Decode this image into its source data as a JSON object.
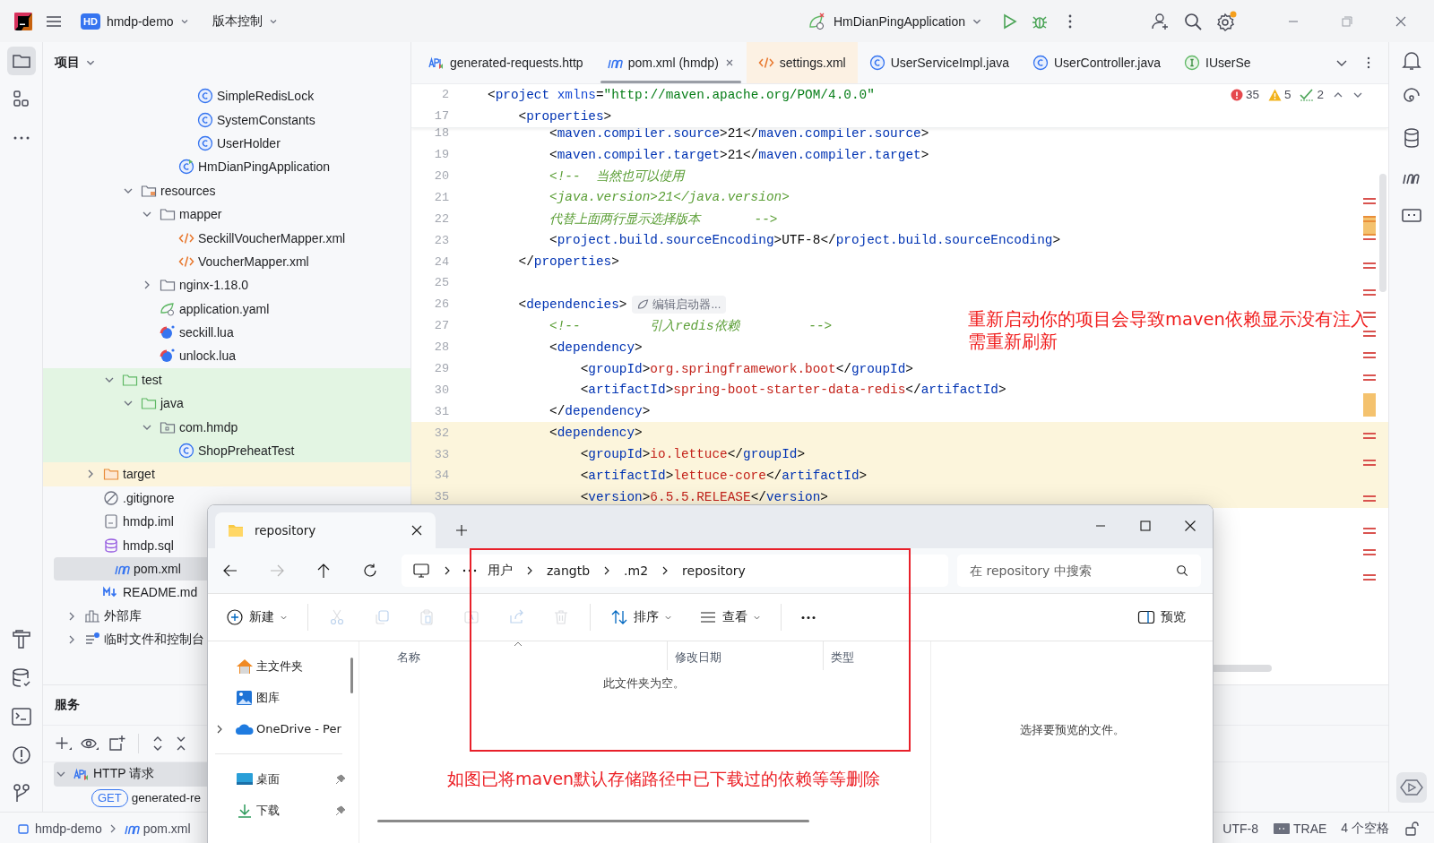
{
  "title_bar": {
    "project_badge": "HD",
    "project": "hmdp-demo",
    "vcs_menu": "版本控制",
    "run_configuration": "HmDianPingApplication",
    "settings_badge": true
  },
  "left_toolbar": {
    "project_selected": true
  },
  "project_panel": {
    "title": "项目",
    "tree": [
      {
        "children": [
          {
            "children": [
              {
                "children": [
                  {
                    "children": [
                      {
                        "children": [
                          {
                            "children": [
                              {
                                "label": "SimpleRedisLock",
                                "kind": "class",
                                "selected": false
                              },
                              {
                                "label": "SystemConstants",
                                "kind": "class",
                                "selected": false
                              },
                              {
                                "label": "UserHolder",
                                "kind": "class",
                                "selected": false
                              }
                            ]
                          },
                          {
                            "label": "HmDianPingApplication",
                            "kind": "app",
                            "selected": false
                          }
                        ]
                      }
                    ]
                  },
                  {
                    "label": "resources",
                    "kind": "resources",
                    "expanded": true,
                    "selected": false,
                    "children": [
                      {
                        "label": "mapper",
                        "kind": "folder",
                        "expanded": true,
                        "selected": false,
                        "children": [
                          {
                            "label": "SeckillVoucherMapper.xml",
                            "kind": "xml",
                            "selected": false
                          },
                          {
                            "label": "VoucherMapper.xml",
                            "kind": "xml",
                            "selected": false
                          }
                        ]
                      },
                      {
                        "label": "nginx-1.18.0",
                        "kind": "folder",
                        "expanded": false,
                        "selected": false
                      },
                      {
                        "label": "application.yaml",
                        "kind": "yaml",
                        "selected": false
                      },
                      {
                        "label": "seckill.lua",
                        "kind": "lua",
                        "selected": false
                      },
                      {
                        "label": "unlock.lua",
                        "kind": "lua",
                        "selected": false
                      }
                    ]
                  }
                ]
              },
              {
                "label": "test",
                "kind": "testfolder",
                "expanded": true,
                "selected": false,
                "test_source": true,
                "children": [
                  {
                    "label": "java",
                    "kind": "testfolder",
                    "expanded": true,
                    "selected": false,
                    "children": [
                      {
                        "label": "com.hmdp",
                        "kind": "package",
                        "expanded": true,
                        "selected": false,
                        "children": [
                          {
                            "label": "ShopPreheatTest",
                            "kind": "class",
                            "selected": false
                          }
                        ]
                      }
                    ]
                  }
                ]
              }
            ]
          },
          {
            "label": "target",
            "kind": "excludedfolder",
            "expanded": false,
            "selected": false,
            "excluded": true
          },
          {
            "label": ".gitignore",
            "kind": "ignore",
            "selected": false
          },
          {
            "label": "hmdp.iml",
            "kind": "iml",
            "selected": false
          },
          {
            "label": "hmdp.sql",
            "kind": "sql",
            "selected": false
          },
          {
            "label": "pom.xml",
            "kind": "maven",
            "selected": true
          },
          {
            "label": "README.md",
            "kind": "md",
            "selected": false
          }
        ]
      },
      {
        "label": "外部库",
        "kind": "library",
        "expanded": false,
        "selected": false
      },
      {
        "label": "临时文件和控制台",
        "kind": "scratch",
        "expanded": false,
        "selected": false
      }
    ]
  },
  "editor": {
    "tabs": [
      {
        "label": "generated-requests.http",
        "kind": "http",
        "selected": false,
        "tinted": false
      },
      {
        "label": "pom.xml (hmdp)",
        "kind": "maven",
        "selected": true,
        "tinted": false
      },
      {
        "label": "settings.xml",
        "kind": "xml",
        "selected": false,
        "tinted": true
      },
      {
        "label": "UserServiceImpl.java",
        "kind": "class",
        "selected": false,
        "tinted": false
      },
      {
        "label": "UserController.java",
        "kind": "class",
        "selected": false,
        "tinted": false
      },
      {
        "label": "IUserSe",
        "kind": "interface",
        "selected": false,
        "tinted": false
      }
    ],
    "inspections": {
      "errors": "35",
      "warnings": "5",
      "typos": "2"
    },
    "sticky_lines": [
      {
        "number": "2",
        "segs": [
          {
            "kind": "punct",
            "text": "<"
          },
          {
            "kind": "tag",
            "text": "project"
          },
          {
            "kind": "attr",
            "text": " xmlns"
          },
          {
            "kind": "punct",
            "text": "="
          },
          {
            "kind": "string",
            "text": "\"http://maven.apache.org/POM/4.0.0\""
          }
        ]
      },
      {
        "number": "17",
        "segs": [
          {
            "kind": "punct",
            "text": "    <"
          },
          {
            "kind": "tag",
            "text": "properties"
          },
          {
            "kind": "punct",
            "text": ">"
          }
        ]
      }
    ],
    "lines": [
      {
        "number": "18",
        "highlighted": false,
        "segs": [
          {
            "kind": "punct",
            "text": "        <"
          },
          {
            "kind": "tag",
            "text": "maven.compiler.source"
          },
          {
            "kind": "punct",
            "text": ">"
          },
          {
            "kind": "text",
            "text": "21"
          },
          {
            "kind": "punct",
            "text": "</"
          },
          {
            "kind": "tag",
            "text": "maven.compiler.source"
          },
          {
            "kind": "punct",
            "text": ">"
          }
        ]
      },
      {
        "number": "19",
        "highlighted": false,
        "segs": [
          {
            "kind": "punct",
            "text": "        <"
          },
          {
            "kind": "tag",
            "text": "maven.compiler.target"
          },
          {
            "kind": "punct",
            "text": ">"
          },
          {
            "kind": "text",
            "text": "21"
          },
          {
            "kind": "punct",
            "text": "</"
          },
          {
            "kind": "tag",
            "text": "maven.compiler.target"
          },
          {
            "kind": "punct",
            "text": ">"
          }
        ]
      },
      {
        "number": "20",
        "highlighted": false,
        "segs": [
          {
            "kind": "comment",
            "text": "        <!--  当然也可以使用"
          }
        ]
      },
      {
        "number": "21",
        "highlighted": false,
        "segs": [
          {
            "kind": "comment",
            "text": "        <java.version>21</java.version>"
          }
        ]
      },
      {
        "number": "22",
        "highlighted": false,
        "segs": [
          {
            "kind": "comment",
            "text": "        代替上面两行显示选择版本       -->"
          }
        ]
      },
      {
        "number": "23",
        "highlighted": false,
        "segs": [
          {
            "kind": "punct",
            "text": "        <"
          },
          {
            "kind": "tag",
            "text": "project.build.sourceEncoding"
          },
          {
            "kind": "punct",
            "text": ">"
          },
          {
            "kind": "text",
            "text": "UTF-8"
          },
          {
            "kind": "punct",
            "text": "</"
          },
          {
            "kind": "tag",
            "text": "project.build.sourceEncoding"
          },
          {
            "kind": "punct",
            "text": ">"
          }
        ]
      },
      {
        "number": "24",
        "highlighted": false,
        "segs": [
          {
            "kind": "punct",
            "text": "    </"
          },
          {
            "kind": "tag",
            "text": "properties"
          },
          {
            "kind": "punct",
            "text": ">"
          }
        ]
      },
      {
        "number": "25",
        "highlighted": false
      },
      {
        "number": "26",
        "highlighted": false,
        "segs": [
          {
            "kind": "punct",
            "text": "    <"
          },
          {
            "kind": "tag",
            "text": "dependencies"
          },
          {
            "kind": "punct",
            "text": ">"
          }
        ],
        "hint": "编辑启动器..."
      },
      {
        "number": "27",
        "highlighted": false,
        "segs": [
          {
            "kind": "comment",
            "text": "        <!--         引入redis依赖         -->"
          }
        ]
      },
      {
        "number": "28",
        "highlighted": false,
        "segs": [
          {
            "kind": "punct",
            "text": "        <"
          },
          {
            "kind": "tag",
            "text": "dependency"
          },
          {
            "kind": "punct",
            "text": ">"
          }
        ]
      },
      {
        "number": "29",
        "highlighted": false,
        "segs": [
          {
            "kind": "punct",
            "text": "            <"
          },
          {
            "kind": "tag",
            "text": "groupId"
          },
          {
            "kind": "punct",
            "text": ">"
          },
          {
            "kind": "value",
            "text": "org.springframework.boot"
          },
          {
            "kind": "punct",
            "text": "</"
          },
          {
            "kind": "tag",
            "text": "groupId"
          },
          {
            "kind": "punct",
            "text": ">"
          }
        ]
      },
      {
        "number": "30",
        "highlighted": false,
        "segs": [
          {
            "kind": "punct",
            "text": "            <"
          },
          {
            "kind": "tag",
            "text": "artifactId"
          },
          {
            "kind": "punct",
            "text": ">"
          },
          {
            "kind": "value",
            "text": "spring-boot-starter-data-redis"
          },
          {
            "kind": "punct",
            "text": "</"
          },
          {
            "kind": "tag",
            "text": "artifactId"
          },
          {
            "kind": "punct",
            "text": ">"
          }
        ]
      },
      {
        "number": "31",
        "highlighted": false,
        "segs": [
          {
            "kind": "punct",
            "text": "        </"
          },
          {
            "kind": "tag",
            "text": "dependency"
          },
          {
            "kind": "punct",
            "text": ">"
          }
        ]
      },
      {
        "number": "32",
        "highlighted": true,
        "segs": [
          {
            "kind": "punct",
            "text": "        <"
          },
          {
            "kind": "tag",
            "text": "dependency"
          },
          {
            "kind": "punct",
            "text": ">"
          }
        ]
      },
      {
        "number": "33",
        "highlighted": true,
        "segs": [
          {
            "kind": "punct",
            "text": "            <"
          },
          {
            "kind": "tag",
            "text": "groupId"
          },
          {
            "kind": "punct",
            "text": ">"
          },
          {
            "kind": "value",
            "text": "io.lettuce"
          },
          {
            "kind": "punct",
            "text": "</"
          },
          {
            "kind": "tag",
            "text": "groupId"
          },
          {
            "kind": "punct",
            "text": ">"
          }
        ]
      },
      {
        "number": "34",
        "highlighted": true,
        "segs": [
          {
            "kind": "punct",
            "text": "            <"
          },
          {
            "kind": "tag",
            "text": "artifactId"
          },
          {
            "kind": "punct",
            "text": ">"
          },
          {
            "kind": "value",
            "text": "lettuce-core"
          },
          {
            "kind": "punct",
            "text": "</"
          },
          {
            "kind": "tag",
            "text": "artifactId"
          },
          {
            "kind": "punct",
            "text": ">"
          }
        ]
      },
      {
        "number": "35",
        "highlighted": true,
        "segs": [
          {
            "kind": "punct",
            "text": "            <"
          },
          {
            "kind": "tag",
            "text": "version"
          },
          {
            "kind": "punct",
            "text": ">"
          },
          {
            "kind": "value",
            "text": "6.5.5.RELEASE"
          },
          {
            "kind": "punct",
            "text": "</"
          },
          {
            "kind": "tag",
            "text": "version"
          },
          {
            "kind": "punct",
            "text": ">"
          }
        ]
      }
    ],
    "annotation_lines": [
      "重新启动你的项目会导致maven依赖显示没有注入",
      "需重新刷新"
    ]
  },
  "services_panel": {
    "title": "服务",
    "tree": [
      {
        "label": "HTTP 请求",
        "kind": "http",
        "expanded": true,
        "selected": true,
        "children": [
          {
            "label": "generated-re",
            "method": "GET",
            "selected": false
          }
        ]
      }
    ]
  },
  "status_bar": {
    "breadcrumbs": [
      {
        "label": "hmdp-demo",
        "kind": "module"
      },
      {
        "label": "pom.xml",
        "kind": "maven"
      }
    ],
    "encoding": "UTF-8",
    "plugin": "TRAE",
    "indent": "4 个空格"
  },
  "explorer": {
    "tabs": [
      {
        "label": "repository",
        "selected": true
      }
    ],
    "forward_enabled": false,
    "path": [
      "用户",
      "zangtb",
      ".m2",
      "repository"
    ],
    "search_placeholder": "在 repository 中搜索",
    "commands": [
      {
        "kind": "new",
        "label": "新建",
        "disabled": false
      },
      {
        "kind": "cut",
        "disabled": true
      },
      {
        "kind": "copy",
        "disabled": true
      },
      {
        "kind": "paste",
        "disabled": true
      },
      {
        "kind": "rename",
        "disabled": true
      },
      {
        "kind": "share",
        "disabled": true
      },
      {
        "kind": "delete",
        "disabled": true
      },
      {
        "kind": "sort",
        "label": "排序",
        "disabled": false
      },
      {
        "kind": "view",
        "label": "查看",
        "disabled": false
      },
      {
        "kind": "more",
        "disabled": false
      }
    ],
    "preview_button": "预览",
    "nav": [
      {
        "label": "主文件夹",
        "kind": "home",
        "expandable": false
      },
      {
        "label": "图库",
        "kind": "gallery",
        "expandable": false
      },
      {
        "label": "OneDrive - Per",
        "kind": "cloud",
        "expandable": true
      }
    ],
    "quick_access": [
      {
        "label": "桌面",
        "kind": "desktop",
        "pinned": true
      },
      {
        "label": "下载",
        "kind": "download",
        "pinned": true
      }
    ],
    "columns": [
      "名称",
      "修改日期",
      "类型"
    ],
    "empty_message": "此文件夹为空。",
    "preview_message": "选择要预览的文件。",
    "annotation": "如图已将maven默认存储路径中已下载过的依赖等等删除"
  }
}
